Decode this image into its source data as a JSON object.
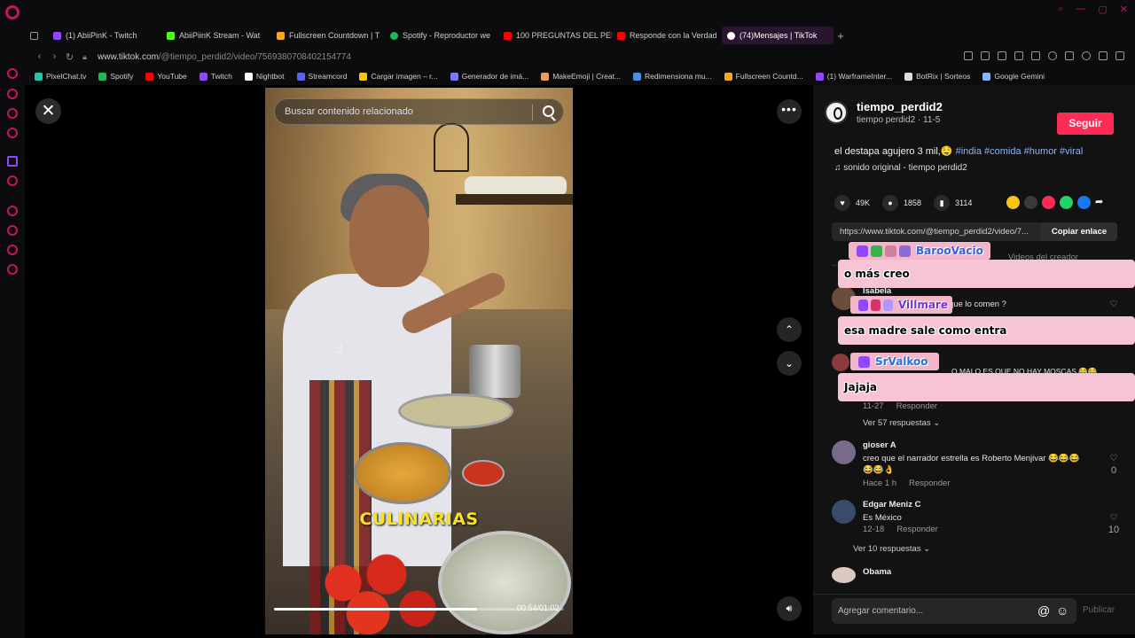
{
  "tabs": [
    {
      "label": "(1) AbiiPinK - Twitch",
      "color": "#9146ff"
    },
    {
      "label": "AbiiPiinK Stream - Wat",
      "color": "#53fc18"
    },
    {
      "label": "Fullscreen Countdown | T",
      "color": "#f5a623"
    },
    {
      "label": "Spotify - Reproductor we",
      "color": "#1db954"
    },
    {
      "label": "100 PREGUNTAS DEL PER",
      "color": "#ff0000"
    },
    {
      "label": "Responde con la Verdad",
      "color": "#ff0000"
    },
    {
      "label": "(74)Mensajes | TikTok",
      "color": "#ffffff"
    }
  ],
  "address": {
    "host": "www.tiktok.com",
    "path": "/@tiempo_perdid2/video/7569380708402154774"
  },
  "bookmarks": [
    {
      "label": "PixelChat.tv",
      "color": "#27c4a8"
    },
    {
      "label": "Spotify",
      "color": "#1db954"
    },
    {
      "label": "YouTube",
      "color": "#ff0000"
    },
    {
      "label": "Twitch",
      "color": "#9146ff"
    },
    {
      "label": "Nightbot",
      "color": "#ffffff"
    },
    {
      "label": "Streamcord",
      "color": "#5865f2"
    },
    {
      "label": "Cargar imagen – r...",
      "color": "#f5c518"
    },
    {
      "label": "Generador de imá...",
      "color": "#7a7aff"
    },
    {
      "label": "MakeEmoji | Creat...",
      "color": "#e0a060"
    },
    {
      "label": "Redimensiona mu...",
      "color": "#4a90e2"
    },
    {
      "label": "Fullscreen Countd...",
      "color": "#f5a623"
    },
    {
      "label": "(1) WarframeInter...",
      "color": "#9146ff"
    },
    {
      "label": "BotRix | Sorteos",
      "color": "#dddddd"
    },
    {
      "label": "Google Gemini",
      "color": "#8ab4f8"
    }
  ],
  "video": {
    "search_placeholder": "Buscar contenido relacionado",
    "caption": "CULINARIAS",
    "time": "00:54/01:02",
    "progress": 0.7
  },
  "post": {
    "username": "tiempo_perdid2",
    "meta": "tiempo perdid2 · 11-5",
    "follow_label": "Seguir",
    "description": "el destapa agujero 3 mil,🤤 ",
    "hashtags": [
      "#india",
      "#comida",
      "#humor",
      "#viral"
    ],
    "sound": "♫  sonido original - tiempo perdid2",
    "likes": "49K",
    "comments": "1858",
    "saves": "3114",
    "copy_url": "https://www.tiktok.com/@tiempo_perdid2/video/7...",
    "copy_label": "Copiar enlace",
    "creator_tab": "Videos del creador"
  },
  "comments": [
    {
      "name": "Isabela",
      "text": "que lo comen ?"
    },
    {
      "name": "",
      "text": "O MALO ES QUE NO HAY MOSCAS 😂😂"
    },
    {
      "meta_date": "11-27",
      "reply": "Responder",
      "replies": "Ver 57 respuestas ⌄"
    },
    {
      "name": "gioser A",
      "text": "creo que el narrador estrella es Roberto Menjivar 😂😂😂😂😂👌",
      "date": "Hace 1 h",
      "reply": "Responder",
      "likes": "0"
    },
    {
      "name": "Edgar Meniz C",
      "text": "Es México",
      "date": "12-18",
      "reply": "Responder",
      "likes": "10",
      "replies": "Ver 10 respuestas ⌄"
    },
    {
      "name": "Obama"
    }
  ],
  "comment_input": {
    "placeholder": "Agregar comentario...",
    "publish": "Publicar"
  },
  "chat": [
    {
      "user": "BarooVacio",
      "color": "#3a5fd8",
      "message": "o más creo"
    },
    {
      "user": "Villmare",
      "color": "#7b2fd1",
      "message": "esa madre sale como entra"
    },
    {
      "user": "SrValkoo",
      "color": "#2a6fe0",
      "message": "Jajaja"
    }
  ]
}
